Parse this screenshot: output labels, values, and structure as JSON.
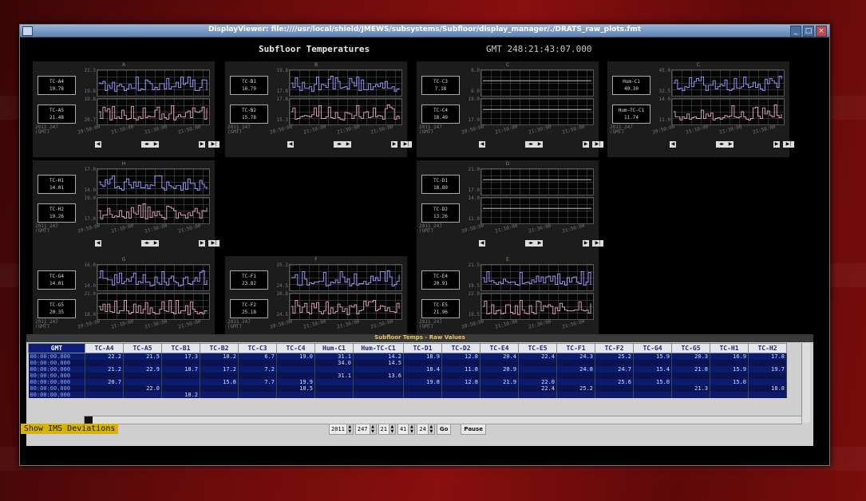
{
  "window": {
    "title": "DisplayViewer: file:////usr/local/shield/JMEWS/subsystems/Subfloor/display_manager/./DRATS_raw_plots.fmt"
  },
  "header": {
    "title": "Subfloor Temperatures",
    "time": "GMT 248:21:43:07.000"
  },
  "colors": {
    "desktop": "#7a0d0d",
    "titlebar": "#5d82b3",
    "trace_top": "#9a96ff",
    "trace_bottom": "#d9a0b0",
    "table_row": "#0c1b6e",
    "ims_button": "#d8b400"
  },
  "panels": [
    {
      "id": "A",
      "letter": "A",
      "box1": {
        "name": "TC-A4",
        "value": "19.78"
      },
      "box2": {
        "name": "TC-A5",
        "value": "21.48"
      },
      "y1": [
        "22.3",
        "19.8"
      ],
      "y2": [
        "19.8",
        "20.7"
      ]
    },
    {
      "id": "B",
      "letter": "B",
      "box1": {
        "name": "TC-B1",
        "value": "16.79"
      },
      "box2": {
        "name": "TC-B2",
        "value": "15.78"
      },
      "y1": [
        "19.8",
        "17.8"
      ],
      "y2": [
        "17.8",
        "15.3"
      ]
    },
    {
      "id": "C",
      "letter": "C",
      "box1": {
        "name": "TC-C3",
        "value": "7.18"
      },
      "box2": {
        "name": "TC-C4",
        "value": "18.49"
      },
      "y1": [
        "8.0",
        "6.0"
      ],
      "y2": [
        "19.0",
        "17.0"
      ]
    },
    {
      "id": "C2",
      "letter": "C",
      "box1": {
        "name": "Hum-C1",
        "value": "40.30"
      },
      "box2": {
        "name": "Hum-TC-C1",
        "value": "11.74"
      },
      "y1": [
        "45.0",
        "32.5"
      ],
      "y2": [
        "14.0",
        "11.0"
      ]
    },
    {
      "id": "H",
      "letter": "H",
      "box1": {
        "name": "TC-H1",
        "value": "14.01"
      },
      "box2": {
        "name": "TC-H2",
        "value": "19.26"
      },
      "y1": [
        "17.0",
        "14.0"
      ],
      "y2": [
        "19.0",
        "17.0"
      ]
    },
    {
      "id": "D",
      "letter": "D",
      "box1": {
        "name": "TC-D1",
        "value": "18.89"
      },
      "box2": {
        "name": "TC-D2",
        "value": "13.26"
      },
      "y1": [
        "21.0",
        "17.0"
      ],
      "y2": [
        "14.0",
        "11.0"
      ]
    },
    {
      "id": "G",
      "letter": "G",
      "box1": {
        "name": "TC-G4",
        "value": "14.01"
      },
      "box2": {
        "name": "TC-G5",
        "value": "20.35"
      },
      "y1": [
        "16.0",
        "14.0"
      ],
      "y2": [
        "21.0",
        "18.0"
      ]
    },
    {
      "id": "F",
      "letter": "F",
      "box1": {
        "name": "TC-F1",
        "value": "23.82"
      },
      "box2": {
        "name": "TC-F2",
        "value": "25.18"
      },
      "y1": [
        "25.2",
        "24.5"
      ],
      "y2": [
        "26.8",
        "24.5"
      ]
    },
    {
      "id": "E",
      "letter": "E",
      "box1": {
        "name": "TC-E4",
        "value": "20.91"
      },
      "box2": {
        "name": "TC-E5",
        "value": "21.96"
      },
      "y1": [
        "21.5",
        "19.5"
      ],
      "y2": [
        "22.0",
        "19.5"
      ]
    }
  ],
  "panel_common": {
    "date1": "2011_247",
    "date2": "(GMT)",
    "xticks": [
      "20:50:00",
      "21:10:00",
      "21:30:00",
      "21:50:00"
    ]
  },
  "table": {
    "title": "Subfloor Temps - Raw Values",
    "columns": [
      "GMT",
      "TC-A4",
      "TC-A5",
      "TC-B1",
      "TC-B2",
      "TC-C3",
      "TC-C4",
      "Hum-C1",
      "Hum-TC-C1",
      "TC-D1",
      "TC-D2",
      "TC-E4",
      "TC-E5",
      "TC-F1",
      "TC-F2",
      "TC-G4",
      "TC-G5",
      "TC-H1",
      "TC-H2"
    ],
    "rows": [
      [
        "00:00:00.000",
        "22.2",
        "21.5",
        "17.3",
        "18.2",
        "6.7",
        "19.0",
        "31.1",
        "14.2",
        "18.9",
        "12.8",
        "20.4",
        "22.4",
        "24.3",
        "25.2",
        "15.9",
        "20.3",
        "16.9",
        "17.8"
      ],
      [
        "00:00:00.000",
        "",
        "",
        "",
        "",
        "",
        "",
        "34.0",
        "14.5",
        "",
        "",
        "",
        "",
        "",
        "",
        "",
        "",
        "",
        ""
      ],
      [
        "00:00:00.000",
        "21.2",
        "22.9",
        "18.7",
        "17.2",
        "7.2",
        "",
        "",
        "",
        "18.4",
        "11.8",
        "20.9",
        "",
        "24.8",
        "24.7",
        "15.4",
        "21.8",
        "15.9",
        "19.7"
      ],
      [
        "00:00:00.000",
        "",
        "",
        "",
        "",
        "",
        "",
        "31.1",
        "13.6",
        "",
        "",
        "",
        "",
        "",
        "",
        "",
        "",
        "",
        ""
      ],
      [
        "00:00:00.000",
        "20.7",
        "",
        "",
        "15.8",
        "7.7",
        "19.9",
        "",
        "",
        "19.8",
        "12.8",
        "21.9",
        "22.0",
        "",
        "25.6",
        "15.0",
        "",
        "15.0",
        ""
      ],
      [
        "00:00:00.000",
        "",
        "22.0",
        "",
        "",
        "",
        "18.5",
        "",
        "",
        "",
        "",
        "",
        "22.4",
        "25.2",
        "",
        "",
        "21.3",
        "",
        "18.8"
      ],
      [
        "00:00:00.000",
        "",
        "",
        "18.2",
        "",
        "",
        "",
        "",
        "",
        "",
        "",
        "",
        "",
        "",
        "",
        "",
        "",
        "",
        ""
      ]
    ]
  },
  "controls": {
    "year": "2011",
    "day": "247",
    "hour": "21",
    "minute": "41",
    "second": "24",
    "go": "Go",
    "pause": "Pause"
  },
  "ims_button": "Show IMS Deviations",
  "icons": {
    "prev": "step-back-icon",
    "zoom": "zoom-fit-icon",
    "next": "step-forward-icon",
    "end": "end-icon"
  }
}
